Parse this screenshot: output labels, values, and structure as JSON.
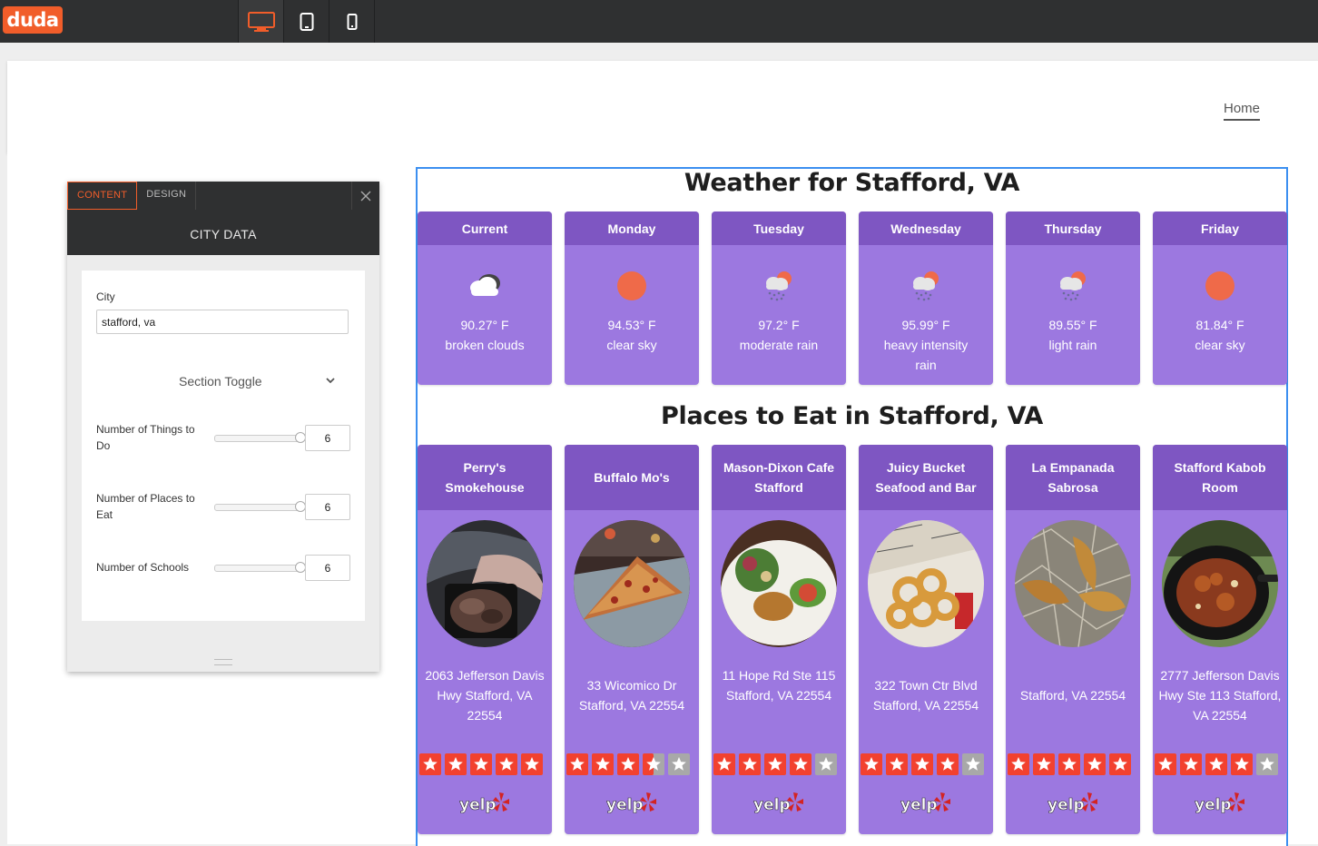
{
  "editor": {
    "logo": "duda",
    "devices": [
      "desktop-icon",
      "tablet-icon",
      "mobile-icon"
    ]
  },
  "site": {
    "nav_home": "Home"
  },
  "panel": {
    "tabs": [
      "CONTENT",
      "DESIGN"
    ],
    "title": "CITY DATA",
    "city_label": "City",
    "city_value": "stafford, va",
    "section_toggle": "Section Toggle",
    "rows": [
      {
        "label": "Number of Things to Do",
        "value": "6"
      },
      {
        "label": "Number of Places to Eat",
        "value": "6"
      },
      {
        "label": "Number of Schools",
        "value": "6"
      }
    ]
  },
  "weather": {
    "title": "Weather for Stafford, VA",
    "days": [
      {
        "day": "Current",
        "temp": "90.27° F",
        "desc": "broken clouds",
        "icon": "cloud-icon"
      },
      {
        "day": "Monday",
        "temp": "94.53° F",
        "desc": "clear sky",
        "icon": "sun-icon"
      },
      {
        "day": "Tuesday",
        "temp": "97.2° F",
        "desc": "moderate rain",
        "icon": "rain-icon"
      },
      {
        "day": "Wednesday",
        "temp": "95.99° F",
        "desc": "heavy intensity rain",
        "icon": "rain-icon"
      },
      {
        "day": "Thursday",
        "temp": "89.55° F",
        "desc": "light rain",
        "icon": "rain-icon"
      },
      {
        "day": "Friday",
        "temp": "81.84° F",
        "desc": "clear sky",
        "icon": "sun-icon"
      }
    ]
  },
  "places": {
    "title": "Places to Eat in Stafford, VA",
    "items": [
      {
        "name": "Perry's Smokehouse",
        "address": "2063 Jefferson Davis Hwy Stafford, VA 22554",
        "rating": 5,
        "photo": "ribs-photo"
      },
      {
        "name": "Buffalo Mo's",
        "address": "33 Wicomico Dr Stafford, VA 22554",
        "rating": 3.5,
        "photo": "pizza-photo"
      },
      {
        "name": "Mason-Dixon Cafe Stafford",
        "address": "11 Hope Rd Ste 115 Stafford, VA 22554",
        "rating": 4,
        "photo": "salad-photo"
      },
      {
        "name": "Juicy Bucket Seafood and Bar",
        "address": "322 Town Ctr Blvd Stafford, VA 22554",
        "rating": 4,
        "photo": "onion-rings-photo"
      },
      {
        "name": "La Empanada Sabrosa",
        "address": "Stafford, VA 22554",
        "rating": 5,
        "photo": "empanada-photo"
      },
      {
        "name": "Stafford Kabob Room",
        "address": "2777 Jefferson Davis Hwy Ste 113 Stafford, VA 22554",
        "rating": 4,
        "photo": "kabob-photo"
      }
    ],
    "brand": "yelp"
  },
  "colors": {
    "accent": "#f15d2a",
    "card": "#9c78e0",
    "card_header": "#7e56c2",
    "star_on": "#f2412f",
    "star_off": "#a8a8a8",
    "selection": "#3c8ff0"
  }
}
